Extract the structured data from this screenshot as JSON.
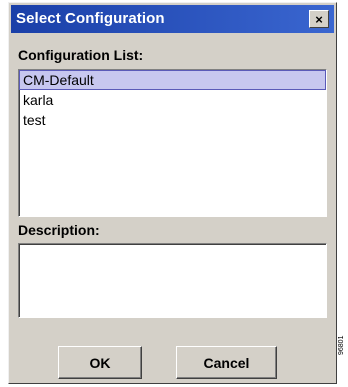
{
  "window": {
    "title": "Select Configuration",
    "close_symbol": "×"
  },
  "configuration_list": {
    "label": "Configuration List:",
    "items": [
      {
        "label": "CM-Default",
        "selected": true
      },
      {
        "label": "karla",
        "selected": false
      },
      {
        "label": "test",
        "selected": false
      }
    ]
  },
  "description": {
    "label": "Description:",
    "value": ""
  },
  "buttons": {
    "ok_label": "OK",
    "cancel_label": "Cancel"
  },
  "figure_id": "96801",
  "colors": {
    "title_bar_start": "#1a3fa8",
    "title_bar_end": "#3a66d0",
    "dialog_face": "#d4d0c8",
    "selection": "#c7c7ef"
  }
}
